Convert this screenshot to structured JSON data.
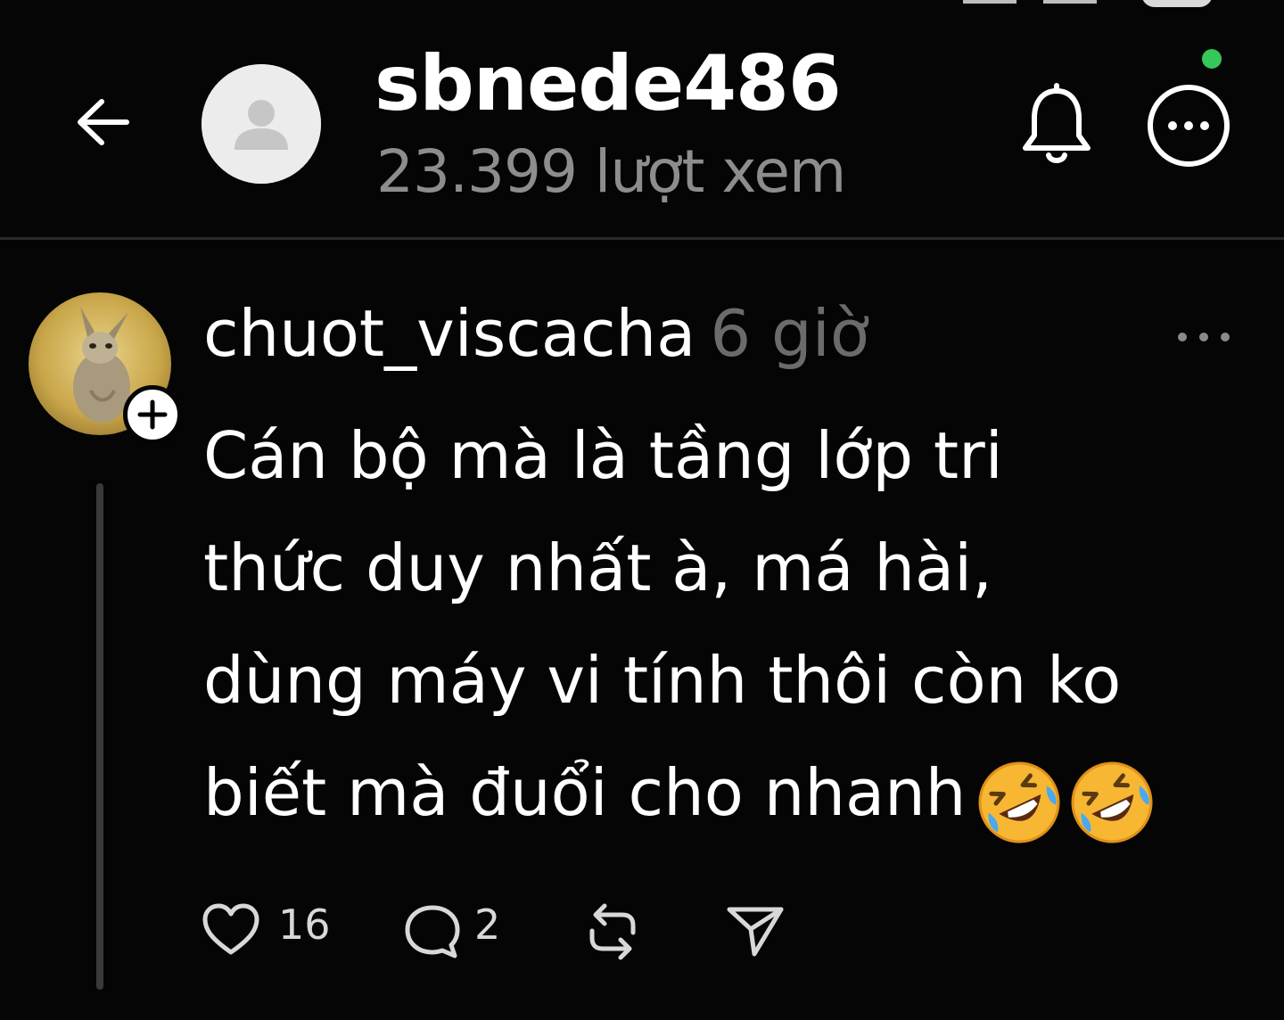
{
  "header": {
    "username": "sbnede486",
    "views": "23.399 lượt xem"
  },
  "comment": {
    "username": "chuot_viscacha",
    "time": "6 giờ",
    "lines": [
      "Cán bộ mà là tầng lớp tri",
      "thức duy nhất à, má hài,",
      "dùng máy vi tính thôi còn ko",
      "biết mà đuổi cho nhanh"
    ],
    "emojis": [
      "rolling-on-floor-laughing",
      "rolling-on-floor-laughing"
    ],
    "likes": "16",
    "replies": "2"
  },
  "icons": {
    "back": "arrow-left-icon",
    "bell": "bell-icon",
    "more": "more-circle-icon",
    "comment_more": "ellipsis-icon",
    "heart": "heart-icon",
    "reply": "speech-bubble-icon",
    "repost": "repost-icon",
    "share": "send-icon",
    "follow": "plus-icon"
  },
  "colors": {
    "background": "#050505",
    "text_primary": "#ffffff",
    "text_muted": "#8d8d8d",
    "online_dot": "#34c759",
    "thread_line": "#3a3a3a"
  }
}
